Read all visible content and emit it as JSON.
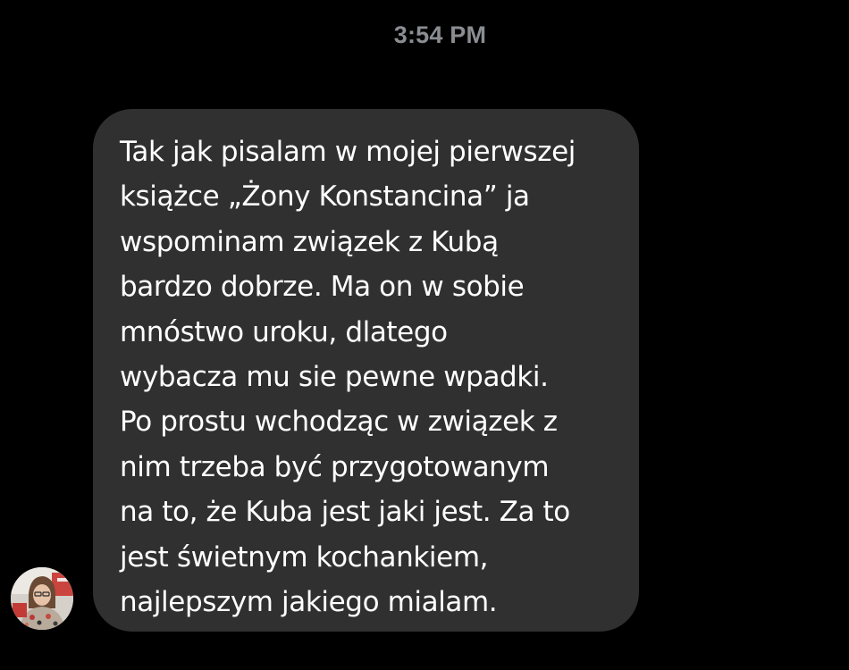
{
  "conversation": {
    "timestamp": "3:54 PM",
    "messages": [
      {
        "sender": "received",
        "avatar_icon": "profile-photo-icon",
        "text": "Tak jak pisalam w mojej pierwszej\nksiążce „Żony Konstancina”  ja\nwspominam związek z Kubą\nbardzo dobrze. Ma on w sobie\nmnóstwo uroku, dlatego\nwybacza mu sie pewne wpadki.\nPo prostu wchodząc w związek z\nnim trzeba być przygotowanym\nna to, że Kuba jest jaki jest. Za to\njest świetnym kochankiem,\nnajlepszym jakiego mialam."
      }
    ]
  },
  "colors": {
    "background": "#000000",
    "bubble": "#303030",
    "text": "#ffffff",
    "timestamp": "#8a8d91"
  }
}
